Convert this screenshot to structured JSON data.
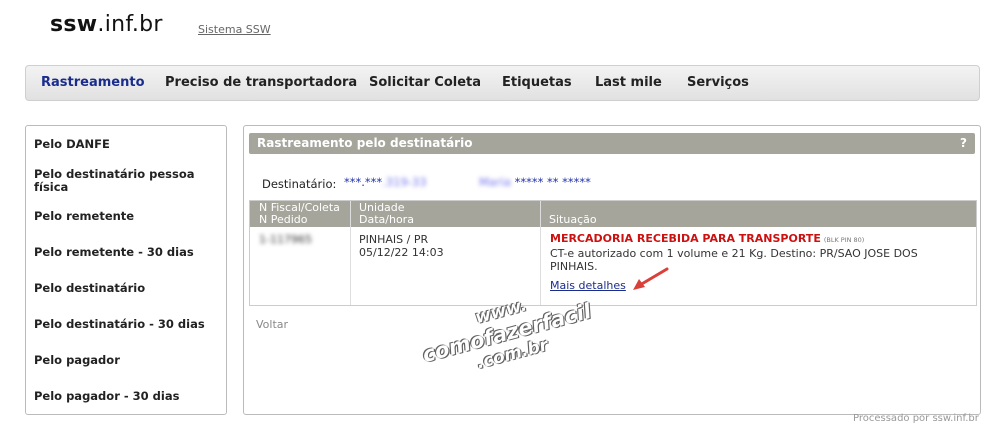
{
  "header": {
    "logo_bold": "ssw",
    "logo_rest": ".inf.br",
    "system_link": "Sistema SSW"
  },
  "nav": {
    "items": [
      "Rastreamento",
      "Preciso de transportadora",
      "Solicitar Coleta",
      "Etiquetas",
      "Last mile",
      "Serviços"
    ],
    "active": "Rastreamento"
  },
  "sidebar": {
    "items": [
      "Pelo DANFE",
      "Pelo destinatário pessoa física",
      "Pelo remetente",
      "Pelo remetente - 30 dias",
      "Pelo destinatário",
      "Pelo destinatário - 30 dias",
      "Pelo pagador",
      "Pelo pagador - 30 dias"
    ]
  },
  "panel": {
    "title": "Rastreamento pelo destinatário",
    "help": "?",
    "destinatario_label": "Destinatário:",
    "destinatario_doc_visible": "***.***",
    "destinatario_doc_blurred": ".319-33",
    "destinatario_name_blurred": "Maria",
    "destinatario_name_visible": "***** ** *****",
    "table": {
      "headers": {
        "col1_line1": "N Fiscal/Coleta",
        "col1_line2": "N Pedido",
        "col2_line1": "Unidade",
        "col2_line2": "Data/hora",
        "col3": "Situação"
      },
      "row": {
        "nf": "1-117965",
        "unidade": "PINHAIS / PR",
        "datahora": "05/12/22 14:03",
        "status_title": "MERCADORIA RECEBIDA PARA TRANSPORTE",
        "status_note": "(BLK PIN 80)",
        "status_desc_line1": "CT-e autorizado com 1 volume e 21 Kg. Destino: PR/SAO JOSE DOS",
        "status_desc_line2": "PINHAIS.",
        "details_link": "Mais detalhes"
      }
    },
    "back": "Voltar"
  },
  "watermark": {
    "line1": "www.",
    "line2": "comofazerfacil",
    "line3": ".com.br"
  },
  "footer": "Processado por ssw.inf.br",
  "colors": {
    "nav_active": "#1a2d8c",
    "header_bar": "#a5a59b",
    "status_red": "#cc1111",
    "arrow_red": "#d9403a"
  }
}
